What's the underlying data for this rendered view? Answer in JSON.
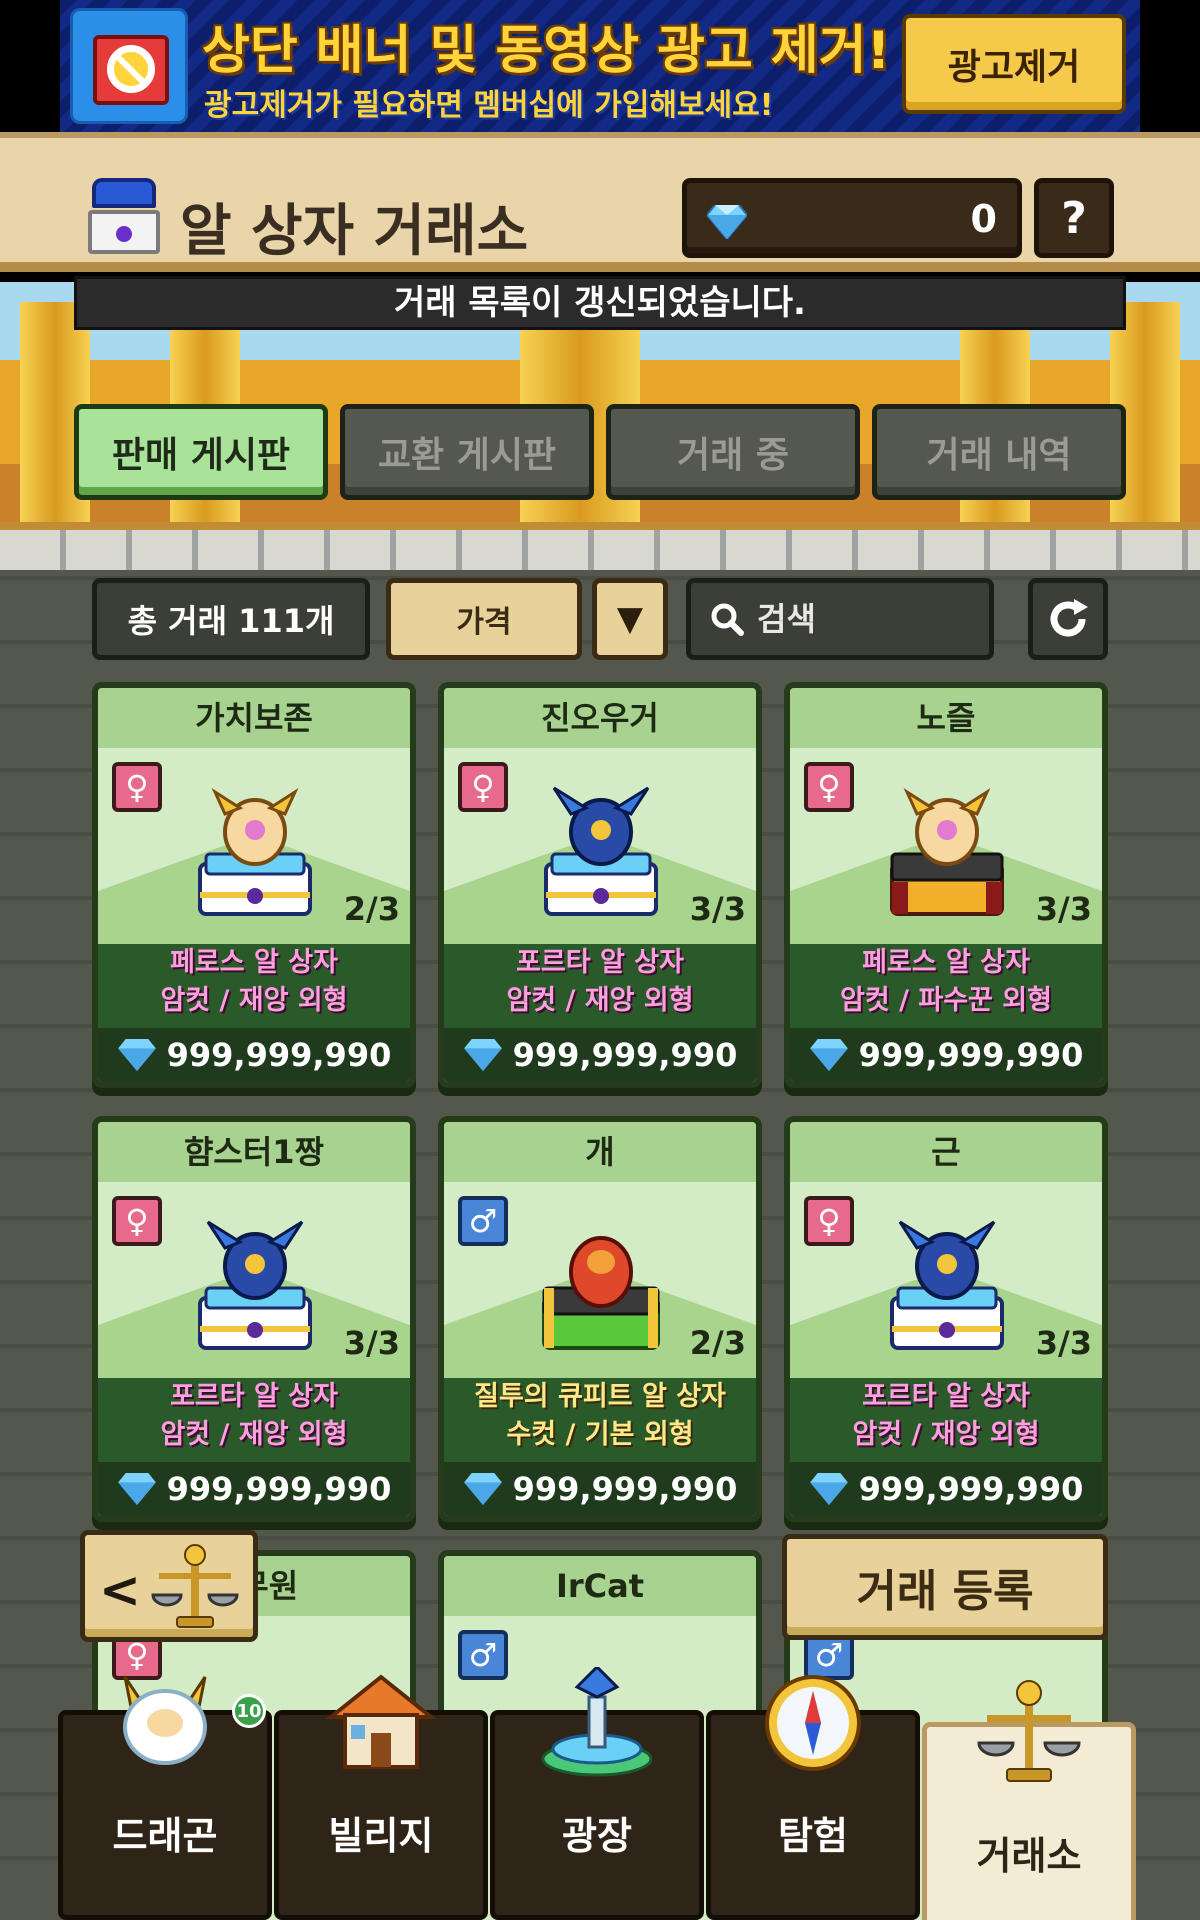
{
  "ad": {
    "title": "상단 배너 및 동영상 광고 제거!",
    "subtitle": "광고제거가 필요하면 멤버십에 가입해보세요!",
    "button": "광고제거"
  },
  "header": {
    "title": "알 상자 거래소",
    "gem_count": "0",
    "help": "?"
  },
  "notice": "거래 목록이 갱신되었습니다.",
  "tabs": [
    {
      "label": "판매 게시판",
      "active": true
    },
    {
      "label": "교환 게시판",
      "active": false
    },
    {
      "label": "거래 중",
      "active": false
    },
    {
      "label": "거래 내역",
      "active": false
    }
  ],
  "filters": {
    "total": "총 거래 111개",
    "sort": "가격",
    "sort_dir": "▼",
    "search_placeholder": "검색"
  },
  "cards": [
    {
      "name": "가치보존",
      "sex": "♀",
      "stage": "2/3",
      "line1": "페로스 알 상자",
      "line2": "암컷 / 재앙 외형",
      "price": "999,999,990",
      "egg": "gold"
    },
    {
      "name": "진오우거",
      "sex": "♀",
      "stage": "3/3",
      "line1": "포르타 알 상자",
      "line2": "암컷 / 재앙 외형",
      "price": "999,999,990",
      "egg": "blue"
    },
    {
      "name": "노즐",
      "sex": "♀",
      "stage": "3/3",
      "line1": "페로스 알 상자",
      "line2": "암컷 / 파수꾼 외형",
      "price": "999,999,990",
      "egg": "dark"
    },
    {
      "name": "햠스터1짱",
      "sex": "♀",
      "stage": "3/3",
      "line1": "포르타 알 상자",
      "line2": "암컷 / 재앙 외형",
      "price": "999,999,990",
      "egg": "blue"
    },
    {
      "name": "개",
      "sex": "♂",
      "stage": "2/3",
      "line1": "질투의 큐피트 알 상자",
      "line2": "수컷 / 기본 외형",
      "price": "999,999,990",
      "egg": "red"
    },
    {
      "name": "근",
      "sex": "♀",
      "stage": "3/3",
      "line1": "포르타 알 상자",
      "line2": "암컷 / 재앙 외형",
      "price": "999,999,990",
      "egg": "blue"
    },
    {
      "name": "공무원",
      "sex": "♀"
    },
    {
      "name": "IrCat",
      "sex": "♂"
    },
    {
      "name": "",
      "sex": "♂"
    }
  ],
  "register_button": "거래 등록",
  "nav": [
    {
      "label": "드래곤",
      "icon": "dragon-icon",
      "badge": "10"
    },
    {
      "label": "빌리지",
      "icon": "house-icon"
    },
    {
      "label": "광장",
      "icon": "fountain-icon"
    },
    {
      "label": "탐험",
      "icon": "compass-icon"
    },
    {
      "label": "거래소",
      "icon": "scale-icon",
      "active": true
    }
  ],
  "colors": {
    "tab_active": "#a9e39a",
    "card_bg": "#d4ecc6",
    "pink_text": "#ff9ee0",
    "yellow_text": "#ffe88a",
    "button_tan": "#e9d29a"
  }
}
